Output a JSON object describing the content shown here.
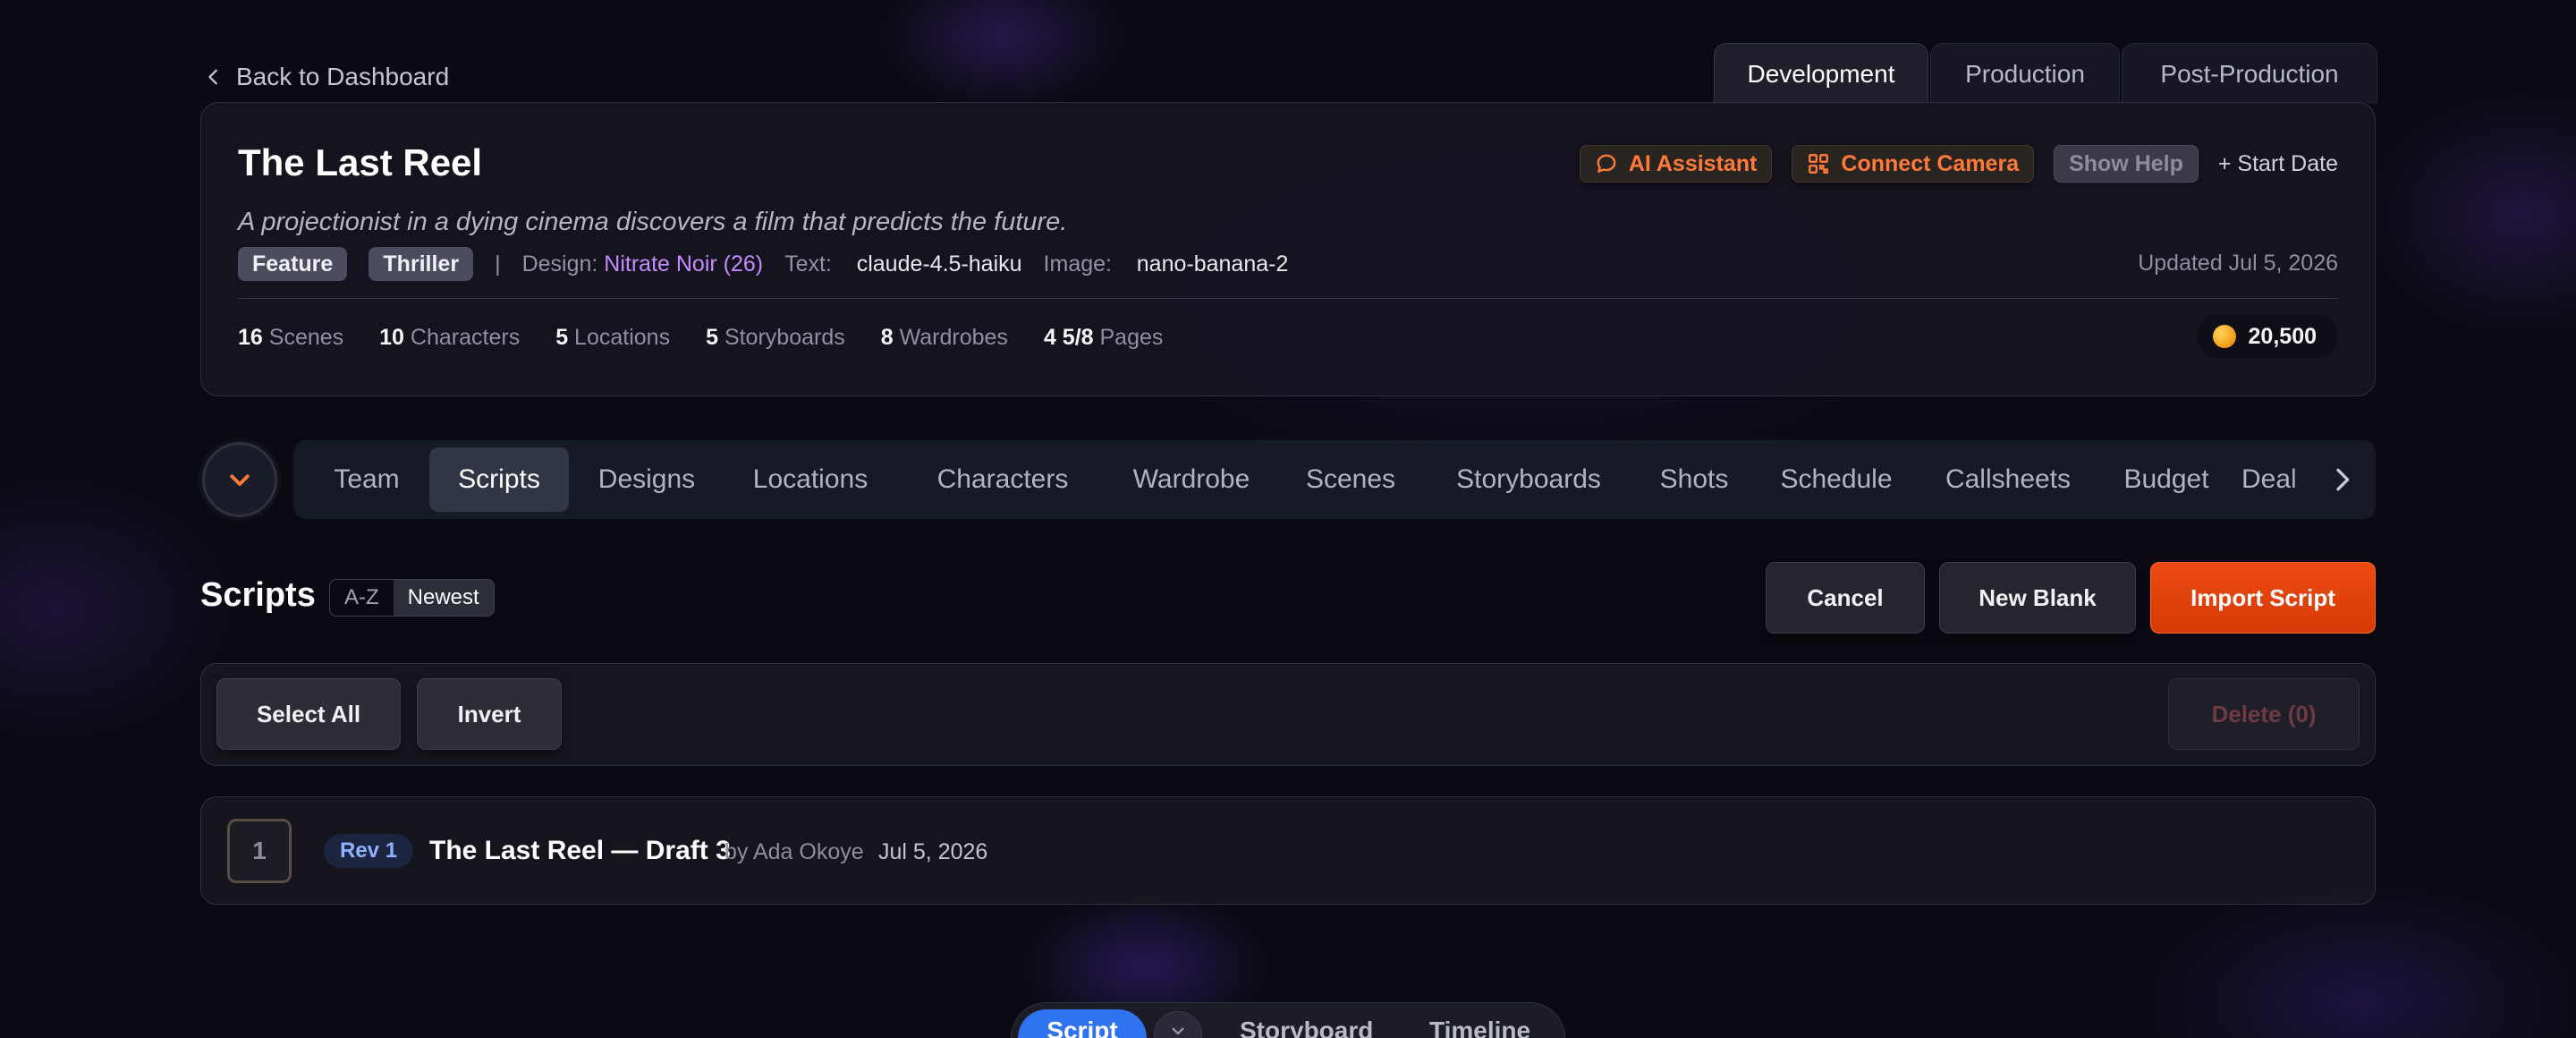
{
  "nav": {
    "back_label": "Back to Dashboard",
    "phase_tabs": [
      "Development",
      "Production",
      "Post-Production"
    ],
    "active_phase": "Development"
  },
  "project": {
    "title": "The Last Reel",
    "logline": "A projectionist in a dying cinema discovers a film that predicts the future.",
    "tags": [
      "Feature",
      "Thriller"
    ],
    "separator": "|",
    "design_label": "Design:",
    "design_value": "Nitrate Noir (26)",
    "text_label": "Text:",
    "text_value": "claude-4.5-haiku",
    "image_label": "Image:",
    "image_value": "nano-banana-2",
    "updated": "Updated Jul 5, 2026",
    "actions": {
      "ai_assistant": "AI Assistant",
      "connect_camera": "Connect Camera",
      "show_help": "Show Help",
      "start_date": "+ Start Date"
    },
    "stats": [
      {
        "value": "16",
        "label": "Scenes"
      },
      {
        "value": "10",
        "label": "Characters"
      },
      {
        "value": "5",
        "label": "Locations"
      },
      {
        "value": "5",
        "label": "Storyboards"
      },
      {
        "value": "8",
        "label": "Wardrobes"
      },
      {
        "value": "4 5/8",
        "label": "Pages"
      }
    ],
    "credits": "20,500"
  },
  "section_tabs": [
    "Team",
    "Scripts",
    "Designs",
    "Locations",
    "Characters",
    "Wardrobe",
    "Scenes",
    "Storyboards",
    "Shots",
    "Schedule",
    "Callsheets",
    "Budget",
    "Deal"
  ],
  "active_section": "Scripts",
  "scripts": {
    "title": "Scripts",
    "sort": [
      "A-Z",
      "Newest"
    ],
    "active_sort": "Newest",
    "cancel_label": "Cancel",
    "new_blank_label": "New Blank",
    "import_label": "Import Script",
    "select_all_label": "Select All",
    "invert_label": "Invert",
    "delete_label": "Delete (0)",
    "rows": [
      {
        "index": "1",
        "revision": "Rev 1",
        "title": "The Last Reel — Draft 3",
        "author": "by Ada Okoye",
        "date": "Jul 5, 2026"
      }
    ]
  },
  "view_switch": {
    "options": [
      "Script",
      "Storyboard",
      "Timeline"
    ],
    "active": "Script"
  },
  "colors": {
    "accent_orange": "#ff7a3a",
    "import_button": "#e2420c",
    "active_view": "#2f73f0",
    "design_value": "#c48bff",
    "rev_badge": "#8fb0ff"
  }
}
